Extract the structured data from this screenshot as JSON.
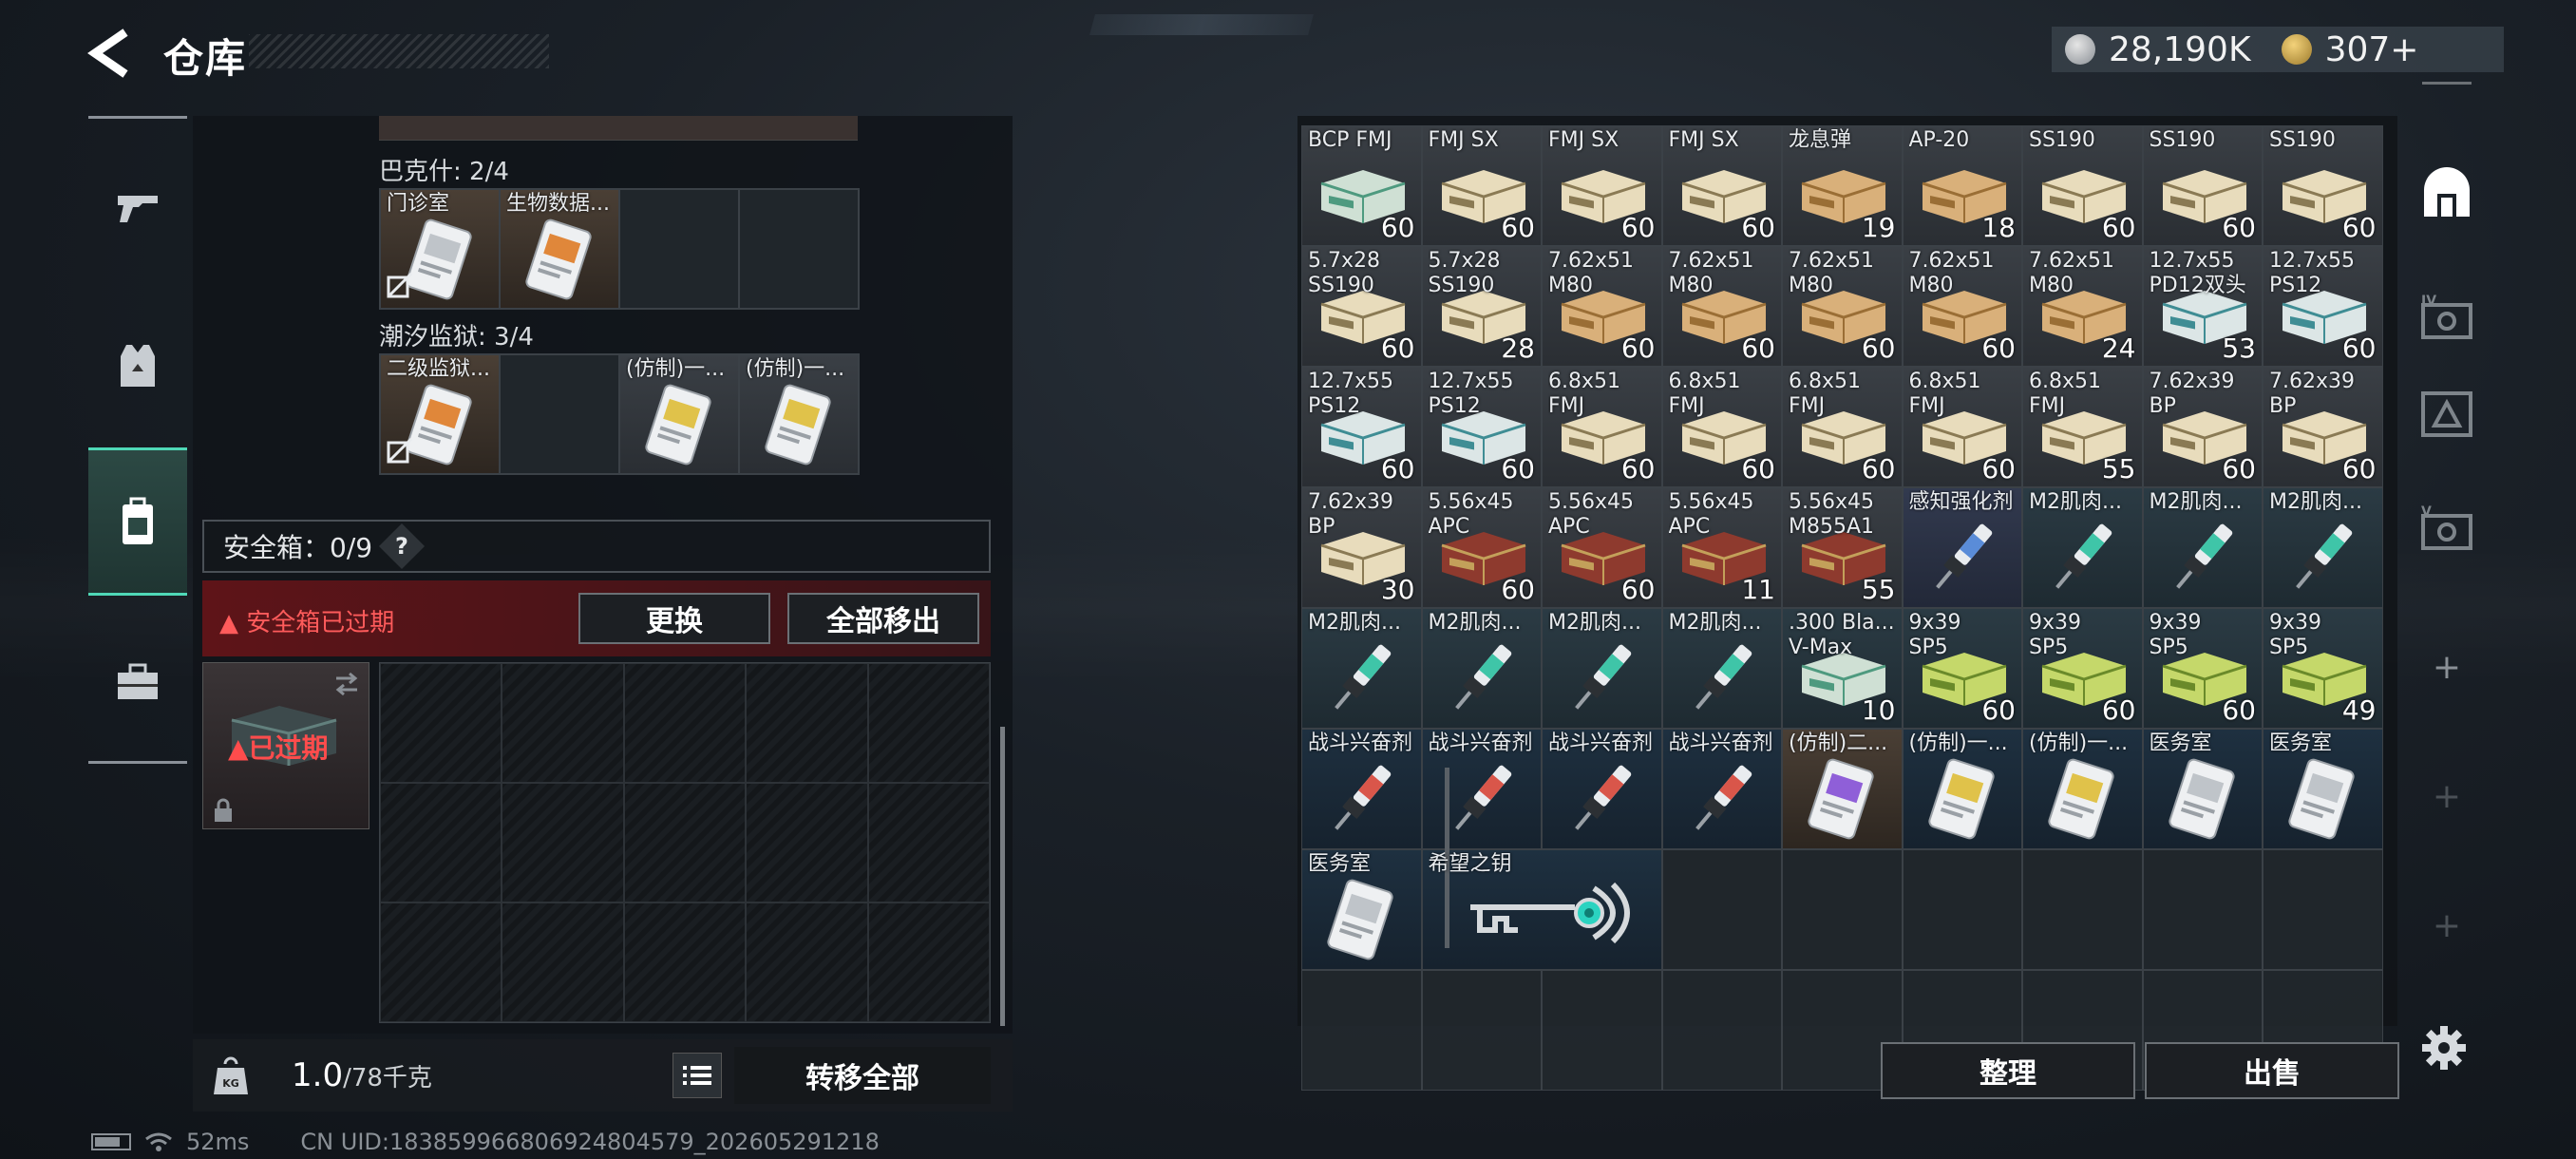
{
  "header": {
    "title": "仓库",
    "currency": [
      {
        "icon": "silver-coin-icon",
        "value": "28,190K"
      },
      {
        "icon": "gold-coin-icon",
        "value": "307+"
      }
    ]
  },
  "left_nav": [
    {
      "icon": "rifle-icon"
    },
    {
      "icon": "armor-vest-icon"
    },
    {
      "icon": "backpack-icon",
      "active": true
    },
    {
      "icon": "toolbox-icon"
    }
  ],
  "loadout": {
    "groups": [
      {
        "label": "巴克什: 2/4",
        "items": [
          {
            "name": "门诊室",
            "bg": "brown",
            "img": "keycard-white",
            "nocarry": true
          },
          {
            "name": "生物数据...",
            "bg": "brown",
            "img": "keycard-orange",
            "nocarry": false
          },
          {
            "name": "",
            "bg": "empty"
          },
          {
            "name": "",
            "bg": "empty"
          }
        ]
      },
      {
        "label": "潮汐监狱: 3/4",
        "items": [
          {
            "name": "二级监狱...",
            "bg": "brown",
            "img": "keycard-orange",
            "nocarry": true
          },
          {
            "name": "",
            "bg": "empty"
          },
          {
            "name": "(仿制)一...",
            "bg": "gray",
            "img": "keycard-gold"
          },
          {
            "name": "(仿制)一...",
            "bg": "gray",
            "img": "keycard-gold"
          }
        ]
      }
    ],
    "safe_box": {
      "label": "安全箱：0/9",
      "help": "?",
      "expired_msg": "安全箱已过期",
      "replace_button": "更换",
      "remove_all_button": "全部移出",
      "expired_tag": "已过期"
    }
  },
  "weight": {
    "value": "1.0",
    "unit": "/78千克",
    "transfer_all_button": "转移全部"
  },
  "stash_items": [
    {
      "name": "BCP FMJ",
      "count": "60",
      "bg": "gray",
      "img": "ammo-box-green"
    },
    {
      "name": "FMJ SX",
      "count": "60",
      "bg": "gray",
      "img": "ammo-box-beige"
    },
    {
      "name": "FMJ SX",
      "count": "60",
      "bg": "gray",
      "img": "ammo-box-beige"
    },
    {
      "name": "FMJ SX",
      "count": "60",
      "bg": "gray",
      "img": "ammo-box-beige"
    },
    {
      "name": "龙息弹",
      "count": "19",
      "bg": "gray",
      "img": "ammo-box-tan"
    },
    {
      "name": "AP-20",
      "count": "18",
      "bg": "gray",
      "img": "ammo-box-tan"
    },
    {
      "name": "SS190",
      "count": "60",
      "bg": "gray",
      "img": "ammo-box-beige"
    },
    {
      "name": "SS190",
      "count": "60",
      "bg": "gray",
      "img": "ammo-box-beige"
    },
    {
      "name": "SS190",
      "count": "60",
      "bg": "gray",
      "img": "ammo-box-beige"
    },
    {
      "name": "5.7x28\nSS190",
      "count": "60",
      "bg": "gray",
      "img": "ammo-box-beige"
    },
    {
      "name": "5.7x28\nSS190",
      "count": "28",
      "bg": "gray",
      "img": "ammo-box-beige"
    },
    {
      "name": "7.62x51\nM80",
      "count": "60",
      "bg": "gray",
      "img": "ammo-box-tan"
    },
    {
      "name": "7.62x51\nM80",
      "count": "60",
      "bg": "gray",
      "img": "ammo-box-tan"
    },
    {
      "name": "7.62x51\nM80",
      "count": "60",
      "bg": "gray",
      "img": "ammo-box-tan"
    },
    {
      "name": "7.62x51\nM80",
      "count": "60",
      "bg": "gray",
      "img": "ammo-box-tan"
    },
    {
      "name": "7.62x51\nM80",
      "count": "24",
      "bg": "gray",
      "img": "ammo-box-tan"
    },
    {
      "name": "12.7x55\nPD12双头",
      "count": "53",
      "bg": "gray",
      "img": "ammo-box-teal"
    },
    {
      "name": "12.7x55\nPS12",
      "count": "60",
      "bg": "gray",
      "img": "ammo-box-teal"
    },
    {
      "name": "12.7x55\nPS12",
      "count": "60",
      "bg": "gray",
      "img": "ammo-box-teal"
    },
    {
      "name": "12.7x55\nPS12",
      "count": "60",
      "bg": "gray",
      "img": "ammo-box-teal"
    },
    {
      "name": "6.8x51\nFMJ",
      "count": "60",
      "bg": "gray",
      "img": "ammo-box-beige"
    },
    {
      "name": "6.8x51\nFMJ",
      "count": "60",
      "bg": "gray",
      "img": "ammo-box-beige"
    },
    {
      "name": "6.8x51\nFMJ",
      "count": "60",
      "bg": "gray",
      "img": "ammo-box-beige"
    },
    {
      "name": "6.8x51\nFMJ",
      "count": "60",
      "bg": "gray",
      "img": "ammo-box-beige"
    },
    {
      "name": "6.8x51\nFMJ",
      "count": "55",
      "bg": "gray",
      "img": "ammo-box-beige"
    },
    {
      "name": "7.62x39\nBP",
      "count": "60",
      "bg": "gray",
      "img": "ammo-box-beige"
    },
    {
      "name": "7.62x39\nBP",
      "count": "60",
      "bg": "gray",
      "img": "ammo-box-beige"
    },
    {
      "name": "7.62x39\nBP",
      "count": "30",
      "bg": "gray",
      "img": "ammo-box-beige"
    },
    {
      "name": "5.56x45\nAPC",
      "count": "60",
      "bg": "gray",
      "img": "ammo-box-red"
    },
    {
      "name": "5.56x45\nAPC",
      "count": "60",
      "bg": "gray",
      "img": "ammo-box-red"
    },
    {
      "name": "5.56x45\nAPC",
      "count": "11",
      "bg": "gray",
      "img": "ammo-box-red"
    },
    {
      "name": "5.56x45\nM855A1",
      "count": "55",
      "bg": "gray",
      "img": "ammo-box-red"
    },
    {
      "name": "感知强化剂",
      "count": "",
      "bg": "blue",
      "img": "injector-blue"
    },
    {
      "name": "M2肌肉...",
      "count": "",
      "bg": "green",
      "img": "injector-teal"
    },
    {
      "name": "M2肌肉...",
      "count": "",
      "bg": "green",
      "img": "injector-teal"
    },
    {
      "name": "M2肌肉...",
      "count": "",
      "bg": "green",
      "img": "injector-teal"
    },
    {
      "name": "M2肌肉...",
      "count": "",
      "bg": "green",
      "img": "injector-teal"
    },
    {
      "name": "M2肌肉...",
      "count": "",
      "bg": "green",
      "img": "injector-teal"
    },
    {
      "name": "M2肌肉...",
      "count": "",
      "bg": "green",
      "img": "injector-teal"
    },
    {
      "name": "M2肌肉...",
      "count": "",
      "bg": "green",
      "img": "injector-teal"
    },
    {
      "name": ".300 Bla...\nV-Max",
      "count": "10",
      "bg": "green",
      "img": "ammo-box-green"
    },
    {
      "name": "9x39\nSP5",
      "count": "60",
      "bg": "green",
      "img": "ammo-box-lime"
    },
    {
      "name": "9x39\nSP5",
      "count": "60",
      "bg": "green",
      "img": "ammo-box-lime"
    },
    {
      "name": "9x39\nSP5",
      "count": "60",
      "bg": "green",
      "img": "ammo-box-lime"
    },
    {
      "name": "9x39\nSP5",
      "count": "49",
      "bg": "green",
      "img": "ammo-box-lime"
    },
    {
      "name": "战斗兴奋剂",
      "count": "",
      "bg": "dark",
      "img": "injector-red"
    },
    {
      "name": "战斗兴奋剂",
      "count": "",
      "bg": "dark",
      "img": "injector-red"
    },
    {
      "name": "战斗兴奋剂",
      "count": "",
      "bg": "dark",
      "img": "injector-red"
    },
    {
      "name": "战斗兴奋剂",
      "count": "",
      "bg": "dark",
      "img": "injector-red"
    },
    {
      "name": "(仿制)二...",
      "count": "",
      "bg": "brown",
      "img": "keycard-purple"
    },
    {
      "name": "(仿制)一...",
      "count": "",
      "bg": "dark",
      "img": "keycard-gold"
    },
    {
      "name": "(仿制)一...",
      "count": "",
      "bg": "dark",
      "img": "keycard-gold"
    },
    {
      "name": "医务室",
      "count": "",
      "bg": "dark",
      "img": "keycard-white"
    },
    {
      "name": "医务室",
      "count": "",
      "bg": "dark",
      "img": "keycard-white"
    },
    {
      "name": "医务室",
      "count": "",
      "bg": "dark",
      "img": "keycard-white"
    },
    {
      "name": "希望之钥",
      "count": "",
      "bg": "dark",
      "img": "ornate-key",
      "span": 2
    },
    {
      "name": "",
      "bg": "empty"
    },
    {
      "name": "",
      "bg": "empty"
    },
    {
      "name": "",
      "bg": "empty"
    },
    {
      "name": "",
      "bg": "empty"
    },
    {
      "name": "",
      "bg": "empty"
    },
    {
      "name": "",
      "bg": "empty"
    },
    {
      "name": "",
      "bg": "empty"
    },
    {
      "name": "",
      "bg": "empty"
    },
    {
      "name": "",
      "bg": "empty"
    },
    {
      "name": "",
      "bg": "empty"
    },
    {
      "name": "",
      "bg": "empty"
    },
    {
      "name": "",
      "bg": "empty"
    },
    {
      "name": "",
      "bg": "empty"
    },
    {
      "name": "",
      "bg": "empty"
    },
    {
      "name": "",
      "bg": "empty"
    }
  ],
  "stash_actions": {
    "sort_button": "整理",
    "sell_button": "出售"
  },
  "right_nav": [
    {
      "icon": "stash-arch-icon",
      "active": true
    },
    {
      "icon": "container-iv-icon"
    },
    {
      "icon": "container-warning-icon"
    },
    {
      "icon": "container-v-icon"
    },
    {
      "icon": "plus-icon",
      "label": "+"
    },
    {
      "icon": "plus-icon",
      "label": "+"
    },
    {
      "icon": "plus-icon",
      "label": "+"
    }
  ],
  "status": {
    "ping": "52ms",
    "uid": "CN UID:1838599668069248045​79_202605291218"
  },
  "colors": {
    "accent": "#4fd8b7",
    "warning": "#ff5b5b",
    "panel": "#101418"
  }
}
